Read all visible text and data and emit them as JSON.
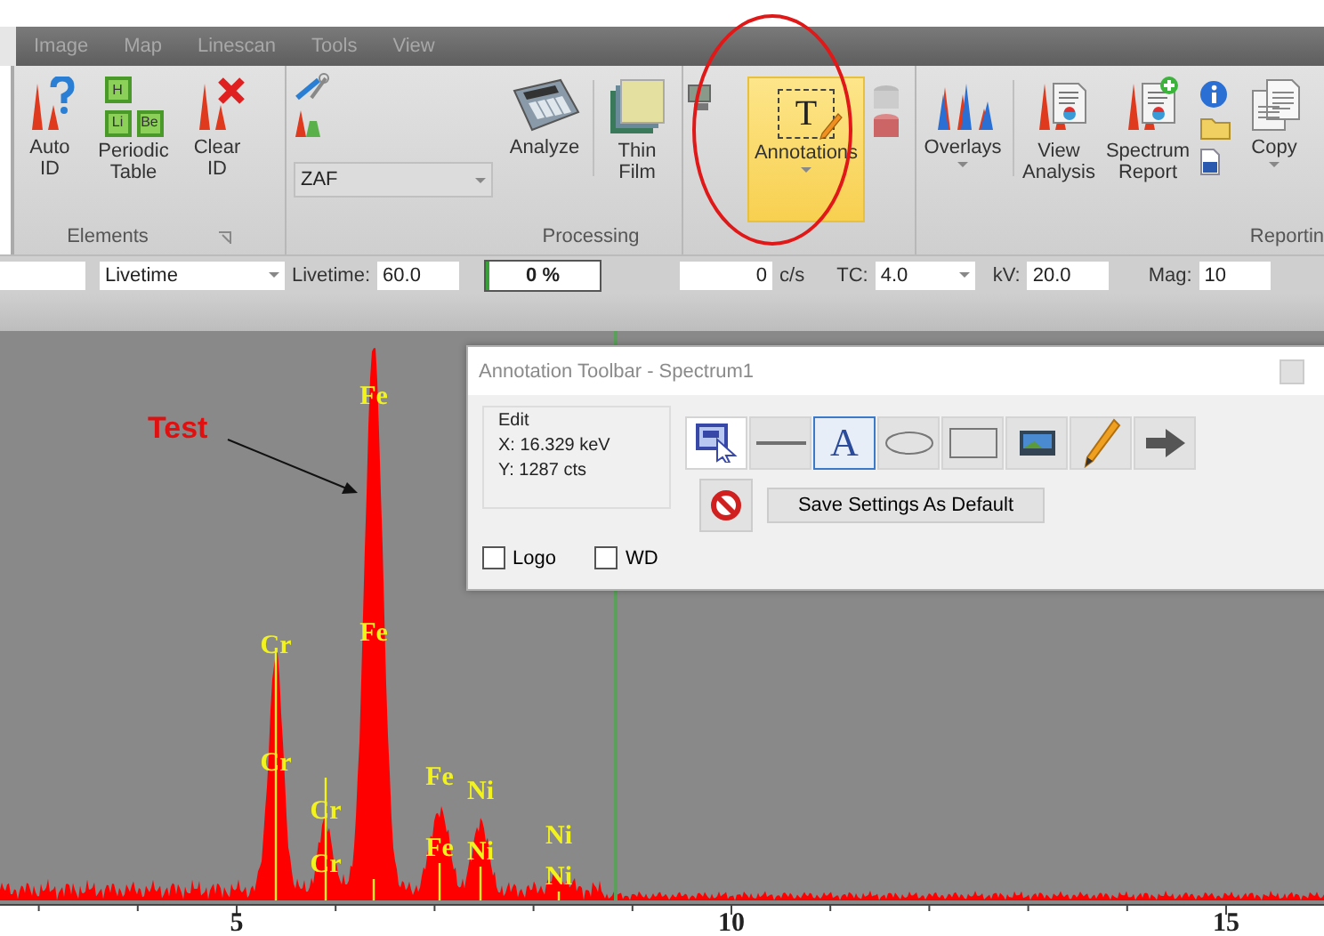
{
  "ribbon": {
    "tabs": [
      {
        "label": "Image",
        "selected": false
      },
      {
        "label": "Map",
        "selected": false
      },
      {
        "label": "Linescan",
        "selected": false
      },
      {
        "label": "Tools",
        "selected": false
      },
      {
        "label": "View",
        "selected": false
      }
    ],
    "elements_group": {
      "label": "Elements",
      "buttons": [
        {
          "label": "Auto ID",
          "kind": "auto-id"
        },
        {
          "label": "Periodic Table",
          "kind": "periodic",
          "tiles": [
            "H",
            "Li",
            "Be"
          ]
        },
        {
          "label": "Clear ID",
          "kind": "clear-id"
        }
      ]
    },
    "processing_group": {
      "label": "Processing",
      "method": "ZAF",
      "buttons": [
        {
          "label": "Analyze",
          "kind": "calculator"
        },
        {
          "label": "Thin Film",
          "kind": "layers"
        }
      ]
    },
    "annotations_button": {
      "label": "Annotations",
      "glyph": "T",
      "highlighted": true
    },
    "reporting_group": {
      "label": "Reportin",
      "buttons": [
        {
          "label": "Overlays",
          "kind": "overlays",
          "dropdown": true
        },
        {
          "label": "View Analysis",
          "kind": "view-analysis",
          "dropdown": false
        },
        {
          "label": "Spectrum Report",
          "kind": "spectrum-report",
          "dropdown": false
        },
        {
          "label": "Copy",
          "kind": "copy",
          "dropdown": true
        }
      ]
    }
  },
  "acquisition_bar": {
    "preset_mode": "Livetime",
    "livetime_label": "Livetime:",
    "livetime": "60.0",
    "progress": {
      "text": "0 %",
      "level": 0
    },
    "rate": "0",
    "rate_unit": "c/s",
    "tc_label": "TC:",
    "tc": "4.0",
    "kv_label": "kV:",
    "kv": "20.0",
    "mag_label": "Mag:",
    "mag": "10"
  },
  "spectrum": {
    "callout": "Test",
    "peak_labels": [
      "Fe",
      "Fe",
      "Cr",
      "Cr",
      "Cr",
      "Cr",
      "Fe",
      "Fe",
      "Ni",
      "Ni",
      "Ni",
      "Ni"
    ],
    "x_tick_labels": [
      "5",
      "10",
      "15"
    ]
  },
  "annotation_toolbar": {
    "title": "Annotation Toolbar - Spectrum1",
    "edit": {
      "label": "Edit",
      "x": "X: 16.329 keV",
      "y": "Y: 1287 cts"
    },
    "tools": [
      {
        "kind": "select",
        "selected": false
      },
      {
        "kind": "line",
        "selected": false
      },
      {
        "kind": "text",
        "glyph": "A",
        "selected": true
      },
      {
        "kind": "ellipse",
        "selected": false
      },
      {
        "kind": "rectangle",
        "selected": false
      },
      {
        "kind": "image",
        "selected": false
      },
      {
        "kind": "pencil",
        "selected": false
      },
      {
        "kind": "arrow",
        "selected": false
      }
    ],
    "save_button": "Save Settings As Default",
    "checkboxes": [
      {
        "label": "Logo",
        "checked": false
      },
      {
        "label": "WD",
        "checked": false
      }
    ]
  }
}
